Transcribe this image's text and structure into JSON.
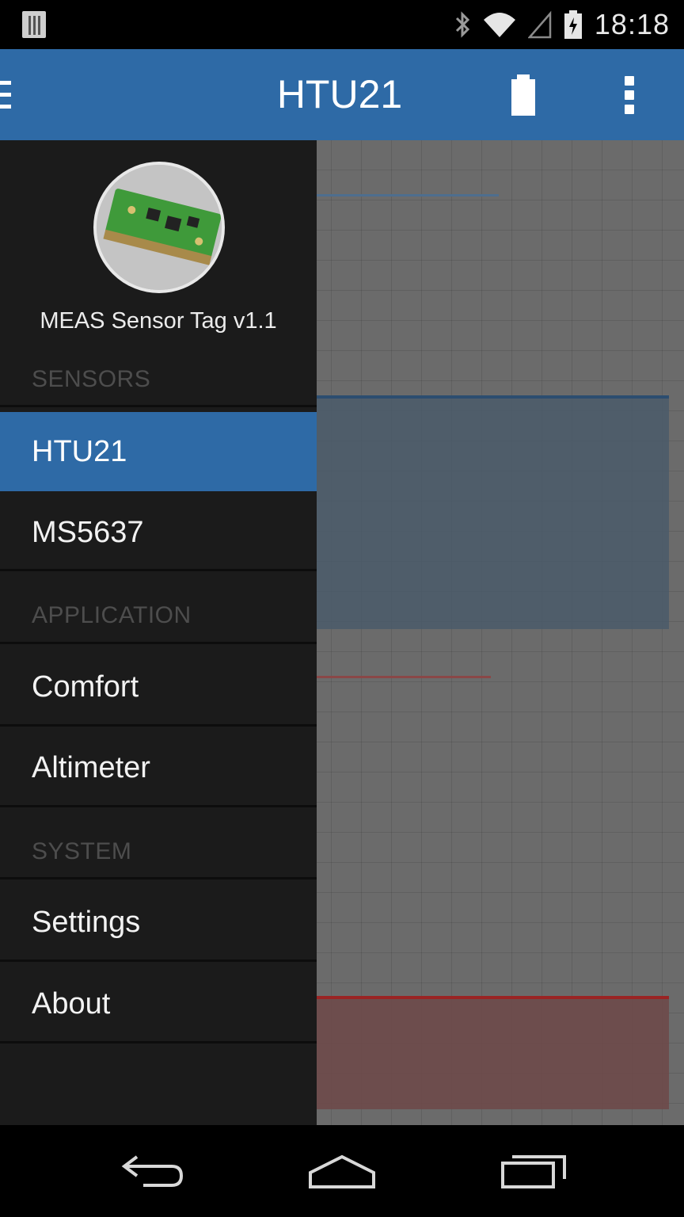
{
  "status_bar": {
    "time": "18:18",
    "icons": [
      "notification-icon",
      "bluetooth-icon",
      "wifi-icon",
      "signal-icon",
      "battery-charging-icon"
    ]
  },
  "action_bar": {
    "title": "HTU21",
    "icons": [
      "menu-icon",
      "battery-icon",
      "overflow-menu-icon"
    ],
    "accent_color": "#2e6aa6"
  },
  "drawer": {
    "device_name": "MEAS Sensor Tag v1.1",
    "sections": [
      {
        "header": "SENSORS",
        "items": [
          {
            "label": "HTU21",
            "selected": true
          },
          {
            "label": "MS5637",
            "selected": false
          }
        ]
      },
      {
        "header": "APPLICATION",
        "items": [
          {
            "label": "Comfort",
            "selected": false
          },
          {
            "label": "Altimeter",
            "selected": false
          }
        ]
      },
      {
        "header": "SYSTEM",
        "items": [
          {
            "label": "Settings",
            "selected": false
          },
          {
            "label": "About",
            "selected": false
          }
        ]
      }
    ]
  },
  "content": {
    "series_colors": {
      "humidity": "#2c4d70",
      "temperature": "#9a2424"
    }
  },
  "nav_bar": {
    "icons": [
      "back-icon",
      "home-icon",
      "recent-apps-icon"
    ]
  }
}
